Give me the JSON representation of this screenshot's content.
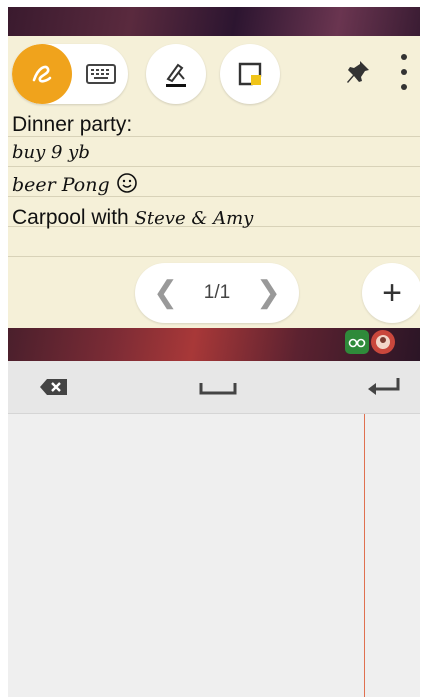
{
  "toolbar": {
    "icons": {
      "handwriting_mode": "handwriting-icon",
      "keyboard_mode": "keyboard-icon",
      "draw": "pen-draw-icon",
      "sticky_note": "sticky-note-icon",
      "pin": "pin-icon",
      "menu": "more-vert-icon"
    },
    "accent_color": "#f0a31c"
  },
  "note": {
    "lines": [
      "Dinner party:",
      "buy 9 yb",
      "beer Pong",
      "Carpool with",
      "Steve & Amy"
    ]
  },
  "pager": {
    "prev_symbol": "❮",
    "page_label": "1/1",
    "next_symbol": "❯",
    "add_symbol": "+"
  },
  "keybar": {
    "icons": [
      "backspace-icon",
      "space-icon",
      "enter-icon"
    ]
  }
}
